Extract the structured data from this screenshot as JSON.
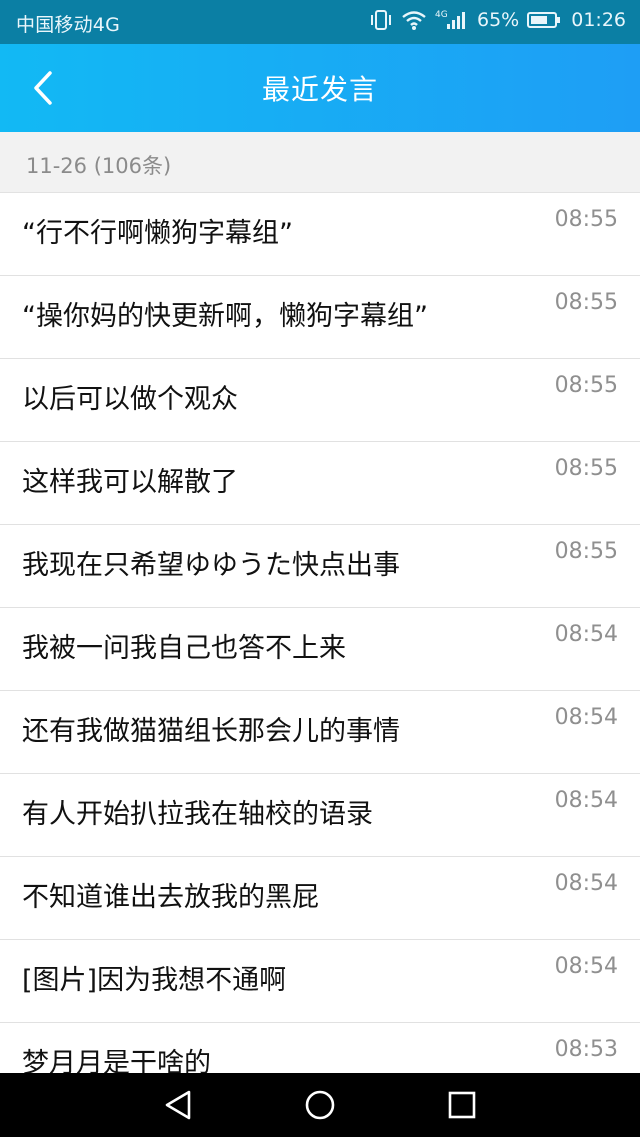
{
  "status_bar": {
    "carrier": "中国移动4G",
    "network": "4G",
    "battery": "65%",
    "time": "01:26",
    "icons": [
      "vibrate-icon",
      "wifi-icon",
      "signal-icon",
      "battery-icon"
    ]
  },
  "header": {
    "title": "最近发言",
    "back_icon": "chevron-left-icon"
  },
  "section": {
    "date_label": "11-26 (106条)"
  },
  "messages": [
    {
      "text": "“行不行啊懒狗字幕组”",
      "time": "08:55"
    },
    {
      "text": "“操你妈的快更新啊，懒狗字幕组”",
      "time": "08:55"
    },
    {
      "text": "以后可以做个观众",
      "time": "08:55"
    },
    {
      "text": "这样我可以解散了",
      "time": "08:55"
    },
    {
      "text": "我现在只希望ゆゆうた快点出事",
      "time": "08:55"
    },
    {
      "text": "我被一问我自己也答不上来",
      "time": "08:54"
    },
    {
      "text": "还有我做猫猫组长那会儿的事情",
      "time": "08:54"
    },
    {
      "text": "有人开始扒拉我在轴校的语录",
      "time": "08:54"
    },
    {
      "text": "不知道谁出去放我的黑屁",
      "time": "08:54"
    },
    {
      "text": "[图片]因为我想不通啊",
      "time": "08:54"
    },
    {
      "text": "梦月月是干啥的",
      "time": "08:53"
    }
  ],
  "nav_bar": {
    "icons": [
      "nav-back-icon",
      "nav-home-icon",
      "nav-recent-icon"
    ]
  },
  "colors": {
    "status_bar_bg": "#0b7fa4",
    "header_gradient_start": "#12b9f4",
    "header_gradient_end": "#1e9ef5",
    "section_bg": "#f2f2f2",
    "nav_bar_bg": "#000000"
  }
}
